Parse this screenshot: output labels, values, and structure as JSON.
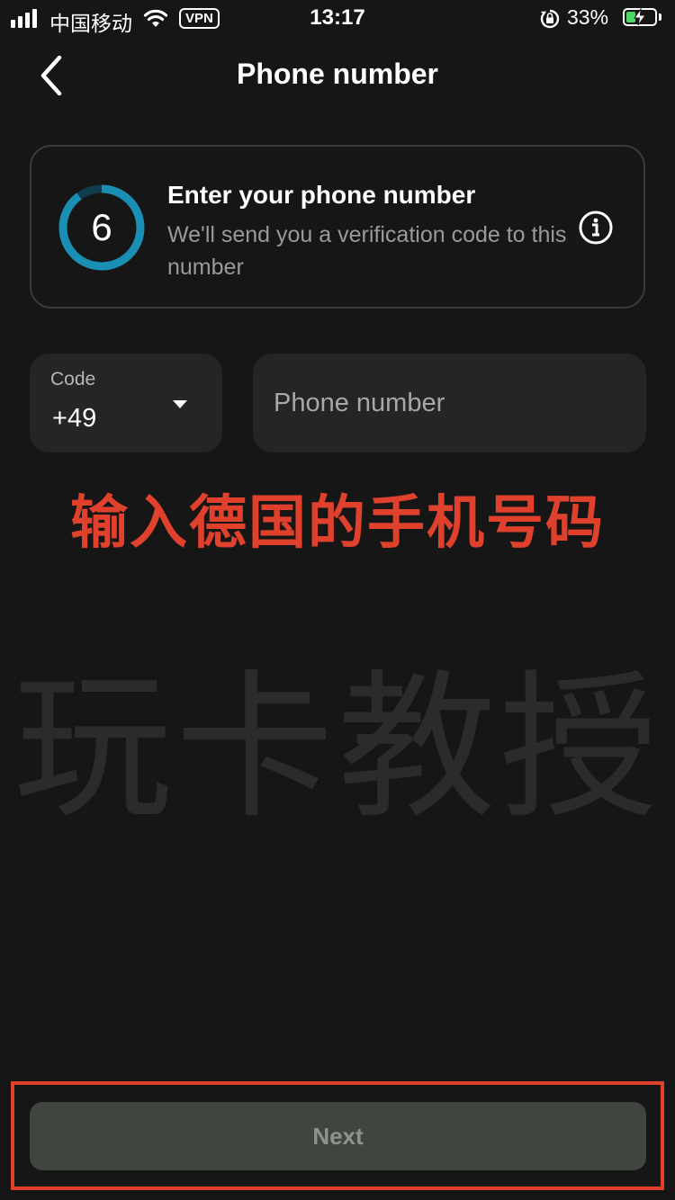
{
  "status_bar": {
    "carrier": "中国移动",
    "vpn": "VPN",
    "time": "13:17",
    "battery_percent": "33%",
    "battery_level": 0.33
  },
  "header": {
    "title": "Phone number"
  },
  "info_card": {
    "step_number": "6",
    "title": "Enter your phone number",
    "subtitle": "We'll send you a verification code to this number"
  },
  "form": {
    "code_label": "Code",
    "code_value": "+49",
    "phone_placeholder": "Phone number",
    "phone_value": ""
  },
  "annotation": {
    "text": "输入德国的手机号码",
    "color": "#e0412d"
  },
  "watermark": {
    "text": "玩卡教授"
  },
  "footer": {
    "next_label": "Next"
  },
  "colors": {
    "background": "#161616",
    "ring_accent": "#1b8fb3",
    "annotation_red": "#e0412d"
  }
}
